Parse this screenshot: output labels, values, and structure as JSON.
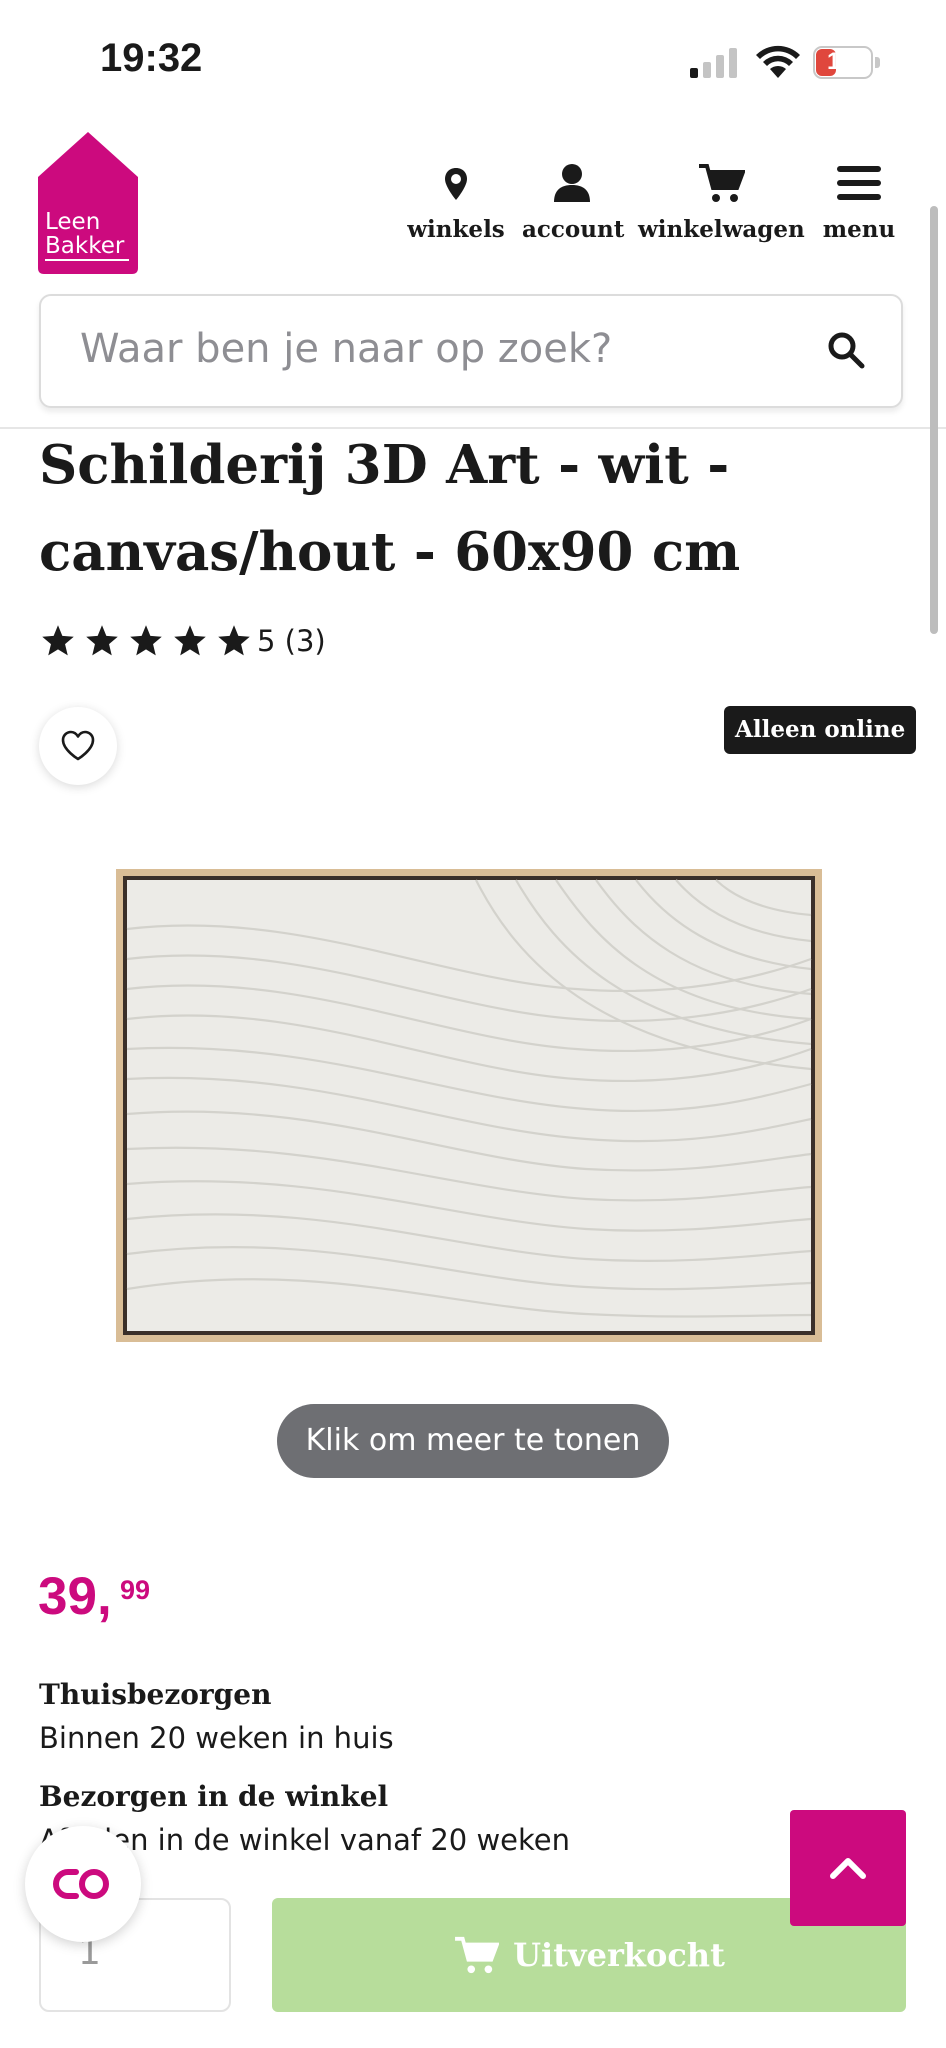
{
  "status_bar": {
    "time": "19:32",
    "battery": "11"
  },
  "brand": {
    "logo_line1": "Leen",
    "logo_line2": "Bakker",
    "color": "#cc0a7e"
  },
  "nav": [
    {
      "label": "winkels",
      "icon": "map-pin-icon"
    },
    {
      "label": "account",
      "icon": "user-icon"
    },
    {
      "label": "winkelwagen",
      "icon": "cart-icon"
    },
    {
      "label": "menu",
      "icon": "hamburger-icon"
    }
  ],
  "search": {
    "placeholder": "Waar ben je naar op zoek?"
  },
  "product": {
    "title_line1": "Schilderij 3D Art - wit -",
    "title_line2": "canvas/hout - 60x90 cm",
    "rating": 5,
    "rating_text": "5 (3)",
    "badge": "Alleen online",
    "more_button": "Klik om meer te tonen",
    "price_main": "39,",
    "price_cents": "99"
  },
  "delivery": [
    {
      "heading": "Thuisbezorgen",
      "text": "Binnen 20 weken in huis"
    },
    {
      "heading": "Bezorgen in de winkel",
      "text": "Afhalen in de winkel vanaf 20 weken"
    }
  ],
  "cart": {
    "quantity": "1",
    "button_label": "Uitverkocht",
    "button_color": "#b7dd9b"
  }
}
